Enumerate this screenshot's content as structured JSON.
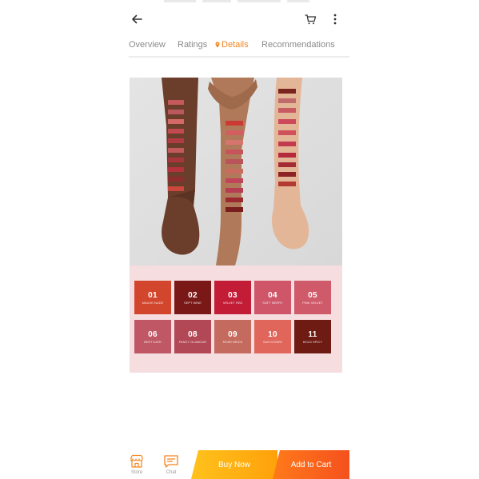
{
  "tabs": [
    {
      "label": "Overview"
    },
    {
      "label": "Ratings"
    },
    {
      "label": "Details"
    },
    {
      "label": "Recommendations"
    }
  ],
  "active_tab": "Details",
  "swatches": [
    {
      "num": "01",
      "name": "Mauve Nude",
      "color": "#d2462d"
    },
    {
      "num": "02",
      "name": "Sept Wine",
      "color": "#7a1818"
    },
    {
      "num": "03",
      "name": "Velvet Red",
      "color": "#c21c36"
    },
    {
      "num": "04",
      "name": "Soft Berry",
      "color": "#cf5569"
    },
    {
      "num": "05",
      "name": "Pink Velvet",
      "color": "#ce5a6a"
    },
    {
      "num": "06",
      "name": "Best Date",
      "color": "#c05765"
    },
    {
      "num": "08",
      "name": "Fancy Glamour",
      "color": "#b24855"
    },
    {
      "num": "09",
      "name": "Rose Brick",
      "color": "#c56a5e"
    },
    {
      "num": "10",
      "name": "Sun Kissed",
      "color": "#e0655a"
    },
    {
      "num": "11",
      "name": "Bold Spicy",
      "color": "#6e1b14"
    }
  ],
  "bottom_bar": {
    "store_label": "Store",
    "chat_label": "Chat",
    "buy_now": "Buy Now",
    "add_to_cart": "Add to Cart"
  },
  "colors": {
    "accent": "#f5841f",
    "buy_now": "#ffb414",
    "add_to_cart": "#f5621e",
    "swatch_panel": "#f6dde0"
  },
  "icons": {
    "back": "arrow-left-icon",
    "cart": "cart-icon",
    "more": "more-vertical-icon",
    "details_pin": "pin-icon",
    "store": "store-icon",
    "chat": "chat-icon"
  }
}
